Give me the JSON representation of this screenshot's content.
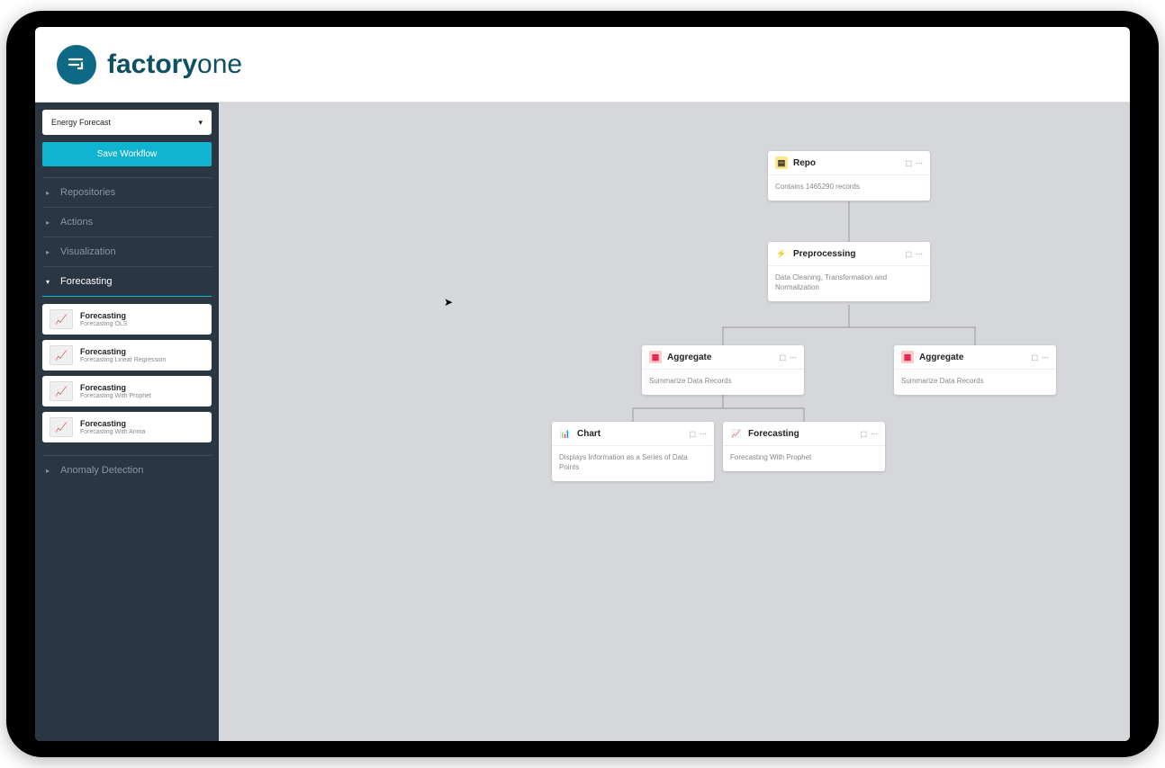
{
  "brand": {
    "bold": "factory",
    "light": "one"
  },
  "sidebar": {
    "workflow_selected": "Energy Forecast",
    "save_label": "Save Workflow",
    "collapse_label": "‹‹",
    "sections": [
      {
        "label": "Repositories"
      },
      {
        "label": "Actions"
      },
      {
        "label": "Visualization"
      },
      {
        "label": "Forecasting"
      },
      {
        "label": "Anomaly Detection"
      }
    ],
    "forecast_items": [
      {
        "title": "Forecasting",
        "subtitle": "Forecasting OLS"
      },
      {
        "title": "Forecasting",
        "subtitle": "Forecasting Linear Regression"
      },
      {
        "title": "Forecasting",
        "subtitle": "Forecasting With Prophet"
      },
      {
        "title": "Forecasting",
        "subtitle": "Forecasting With Arima"
      }
    ]
  },
  "nodes": {
    "repo": {
      "title": "Repo",
      "body": "Contains 1465290 records",
      "icon_color": "#f59e0b"
    },
    "pre": {
      "title": "Preprocessing",
      "body": "Data Cleaning, Transformation and Normalization",
      "icon_color": "#3b82f6"
    },
    "agg1": {
      "title": "Aggregate",
      "body": "Summarize Data Records",
      "icon_color": "#e11d48"
    },
    "agg2": {
      "title": "Aggregate",
      "body": "Summarize Data Records",
      "icon_color": "#e11d48"
    },
    "chart": {
      "title": "Chart",
      "body": "Displays Information as a Series of Data Points",
      "icon_color": "#16a34a"
    },
    "fcast": {
      "title": "Forecasting",
      "body": "Forecasting With Prophet",
      "icon_color": "#0ea5e9"
    }
  },
  "node_actions": {
    "expand": "⬚",
    "menu": "⋯"
  }
}
